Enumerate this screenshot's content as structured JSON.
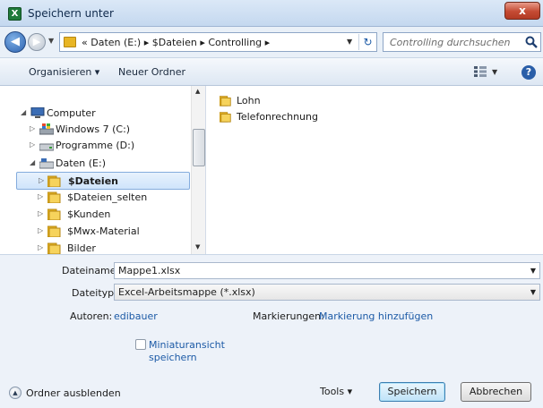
{
  "window": {
    "title": "Speichern unter",
    "close_label": "x"
  },
  "address_bar": {
    "path_text": "« Daten (E:)  ▸  $Dateien  ▸  Controlling  ▸",
    "search_placeholder": "Controlling durchsuchen"
  },
  "toolbar": {
    "organize_label": "Organisieren ▾",
    "new_folder_label": "Neuer Ordner",
    "help_label": "?"
  },
  "nav_pane": {
    "items": [
      {
        "label": "Computer",
        "icon": "computer-icon",
        "expanded": true
      },
      {
        "label": "Windows 7 (C:)",
        "icon": "drive-icon"
      },
      {
        "label": "Programme (D:)",
        "icon": "drive-icon"
      },
      {
        "label": "Daten (E:)",
        "icon": "drive-icon",
        "expanded": true
      },
      {
        "label": "$Dateien",
        "icon": "folder-icon",
        "selected": true
      },
      {
        "label": "$Dateien_selten",
        "icon": "folder-icon"
      },
      {
        "label": "$Kunden",
        "icon": "folder-icon"
      },
      {
        "label": "$Mwx-Material",
        "icon": "folder-icon"
      },
      {
        "label": "Bilder",
        "icon": "folder-icon"
      }
    ]
  },
  "file_list": {
    "items": [
      {
        "label": "Lohn",
        "icon": "folder-icon"
      },
      {
        "label": "Telefonrechnung",
        "icon": "folder-icon"
      }
    ]
  },
  "details": {
    "filename_label": "Dateiname:",
    "filename_value": "Mappe1.xlsx",
    "filetype_label": "Dateityp:",
    "filetype_value": "Excel-Arbeitsmappe (*.xlsx)",
    "authors_label": "Autoren:",
    "authors_value": "edibauer",
    "tags_label": "Markierungen:",
    "tags_value": "Markierung hinzufügen",
    "thumbnail_label_1": "Miniaturansicht",
    "thumbnail_label_2": "speichern",
    "thumbnail_checked": false
  },
  "footer": {
    "hide_folders_label": "Ordner ausblenden",
    "tools_label": "Tools  ▾",
    "save_label": "Speichern",
    "cancel_label": "Abbrechen"
  },
  "colors": {
    "accent": "#1c5aa6",
    "folder": "#e8b524",
    "selection": "#cfe4fb"
  }
}
